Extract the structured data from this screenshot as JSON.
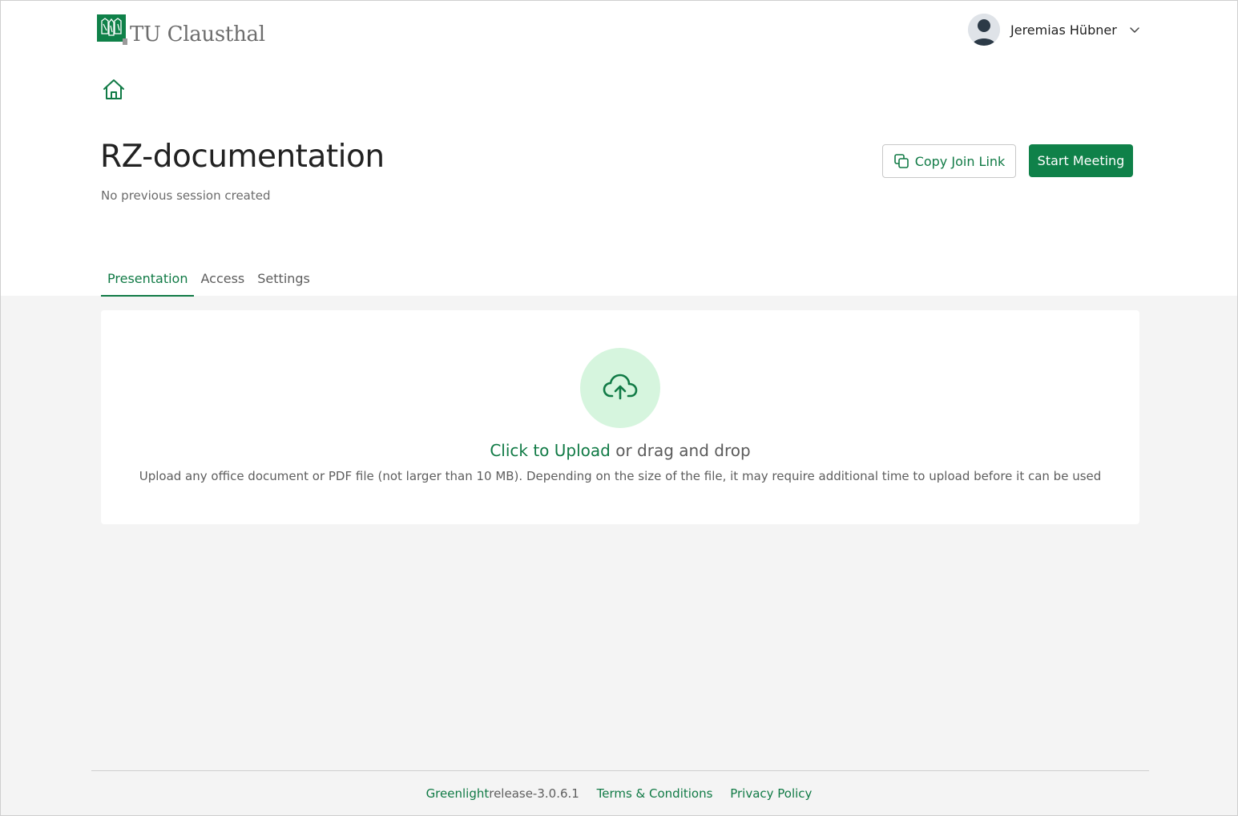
{
  "header": {
    "logo_text": "TU Clausthal",
    "user_name": "Jeremias Hübner"
  },
  "room": {
    "title": "RZ-documentation",
    "subtitle": "No previous session created",
    "copy_join_link_label": "Copy Join Link",
    "start_meeting_label": "Start Meeting"
  },
  "tabs": [
    {
      "label": "Presentation",
      "active": true
    },
    {
      "label": "Access",
      "active": false
    },
    {
      "label": "Settings",
      "active": false
    }
  ],
  "upload": {
    "link_text": "Click to Upload",
    "rest_text": " or drag and drop",
    "hint": "Upload any office document or PDF file (not larger than 10 MB). Depending on the size of the file, it may require additional time to upload before it can be used"
  },
  "footer": {
    "product": "Greenlight",
    "version": " release-3.0.6.1",
    "terms": "Terms & Conditions",
    "privacy": "Privacy Policy"
  },
  "colors": {
    "brand_green": "#0f8149",
    "upload_circle": "#d6f5de",
    "page_bg": "#f4f4f4"
  },
  "icons": [
    "tu-clausthal-logo",
    "user-avatar-icon",
    "chevron-down-icon",
    "home-icon",
    "copy-icon",
    "cloud-upload-icon"
  ]
}
